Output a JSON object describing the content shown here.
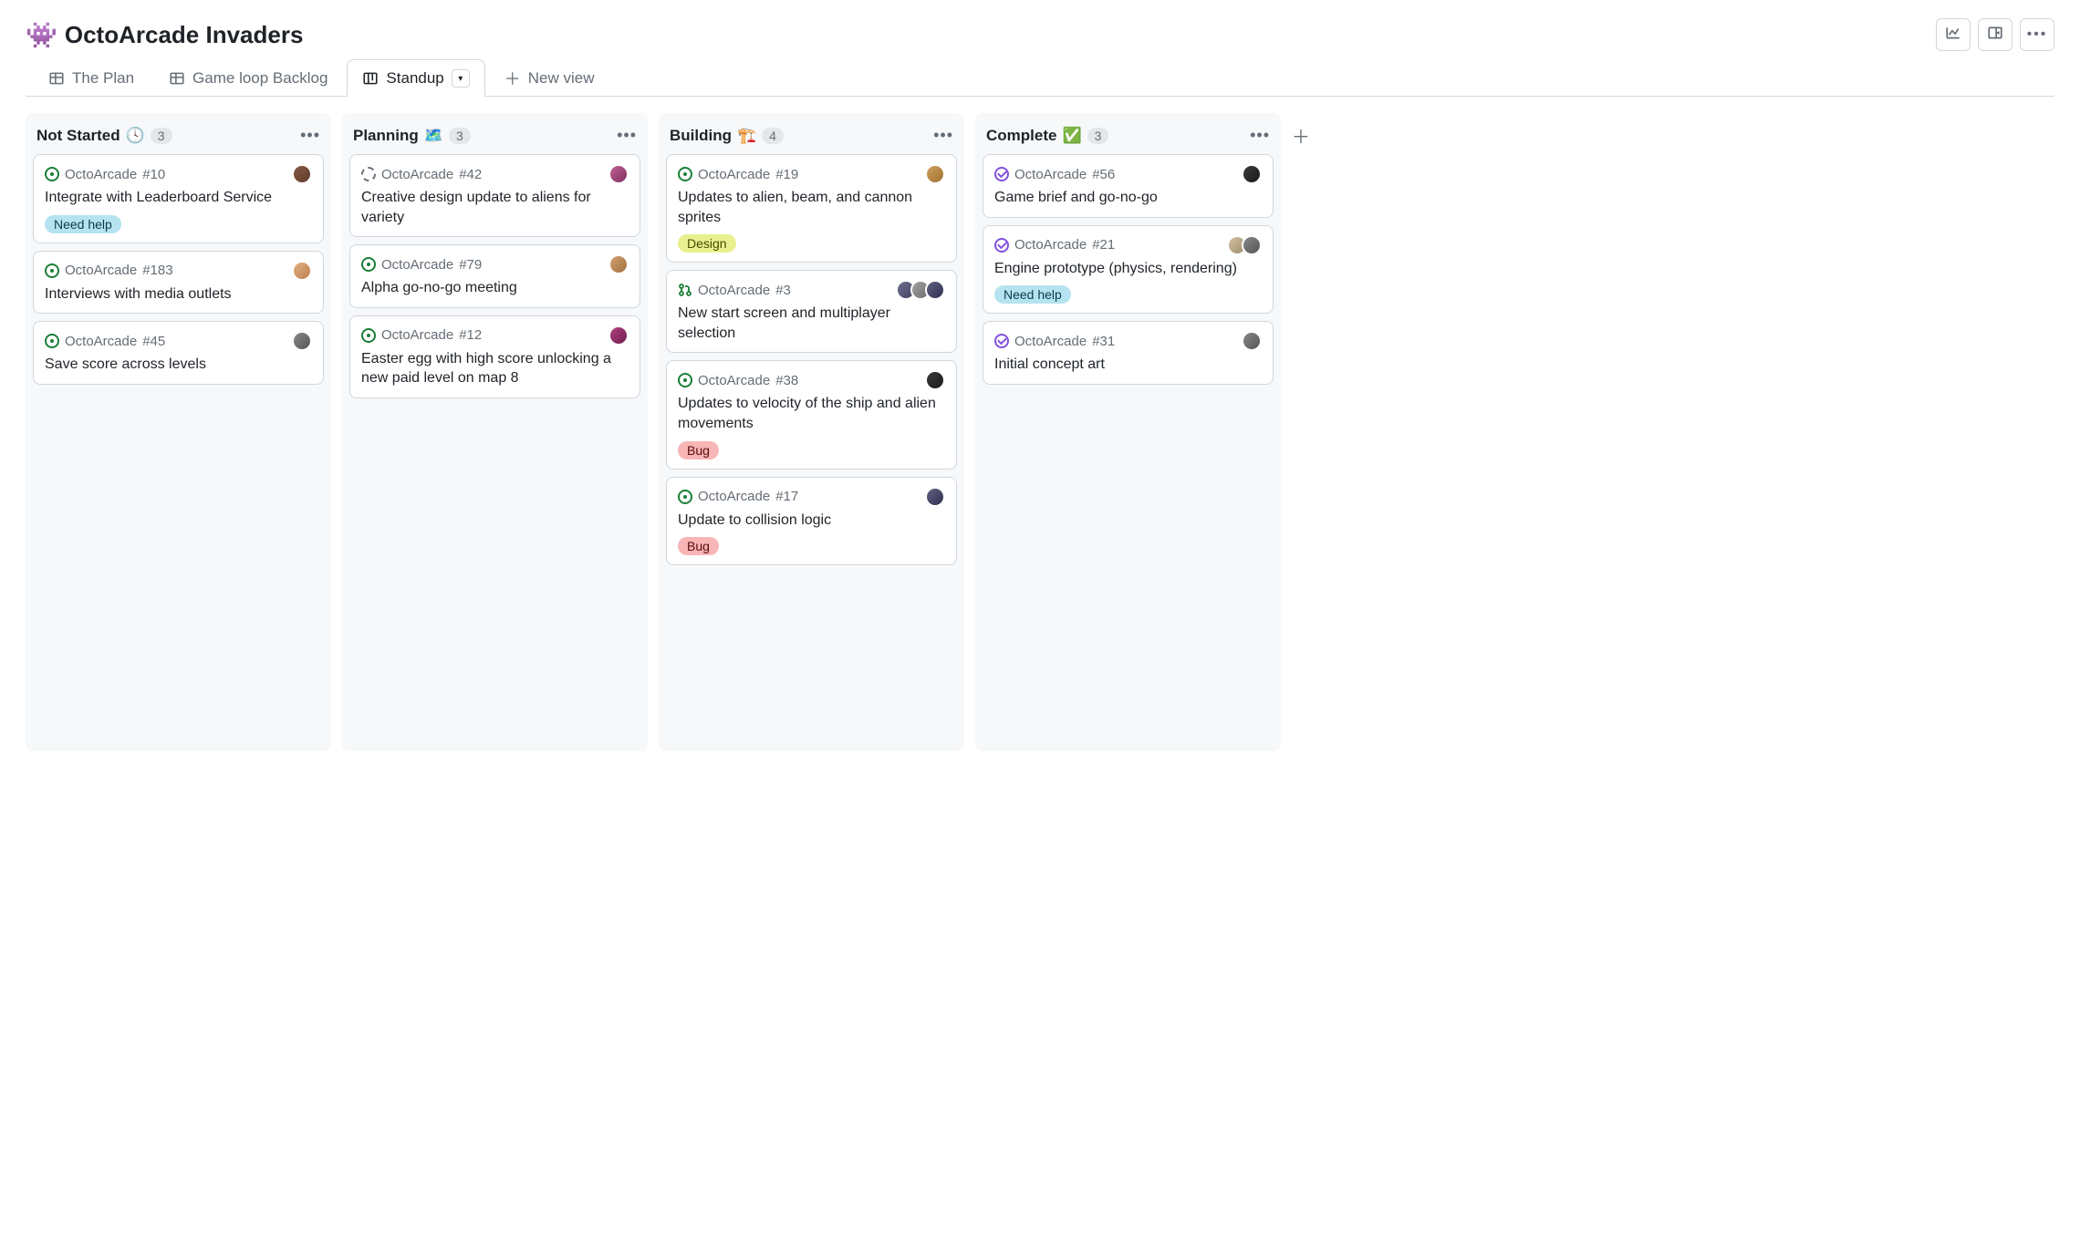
{
  "header": {
    "emoji": "👾",
    "title": "OctoArcade Invaders"
  },
  "tabs": [
    {
      "label": "The Plan",
      "type": "table",
      "active": false
    },
    {
      "label": "Game loop Backlog",
      "type": "table",
      "active": false
    },
    {
      "label": "Standup",
      "type": "board",
      "active": true
    },
    {
      "label": "New view",
      "type": "new",
      "active": false
    }
  ],
  "labels": {
    "needhelp": "Need help",
    "design": "Design",
    "bug": "Bug"
  },
  "columns": [
    {
      "title": "Not Started",
      "emoji": "🕓",
      "count": "3",
      "cards": [
        {
          "repo": "OctoArcade",
          "num": "#10",
          "status": "open",
          "title": "Integrate with Leaderboard Service",
          "labels": [
            "needhelp"
          ],
          "avatars": [
            "av1"
          ]
        },
        {
          "repo": "OctoArcade",
          "num": "#183",
          "status": "open",
          "title": "Interviews with media outlets",
          "labels": [],
          "avatars": [
            "av2"
          ]
        },
        {
          "repo": "OctoArcade",
          "num": "#45",
          "status": "open",
          "title": "Save score across levels",
          "labels": [],
          "avatars": [
            "av3"
          ]
        }
      ]
    },
    {
      "title": "Planning",
      "emoji": "🗺️",
      "count": "3",
      "cards": [
        {
          "repo": "OctoArcade",
          "num": "#42",
          "status": "draft",
          "title": "Creative design update to aliens for variety",
          "labels": [],
          "avatars": [
            "av4"
          ]
        },
        {
          "repo": "OctoArcade",
          "num": "#79",
          "status": "open",
          "title": "Alpha go-no-go meeting",
          "labels": [],
          "avatars": [
            "av5"
          ]
        },
        {
          "repo": "OctoArcade",
          "num": "#12",
          "status": "open",
          "title": "Easter egg with high score unlocking a new paid level on map 8",
          "labels": [],
          "avatars": [
            "av6"
          ]
        }
      ]
    },
    {
      "title": "Building",
      "emoji": "🏗️",
      "count": "4",
      "cards": [
        {
          "repo": "OctoArcade",
          "num": "#19",
          "status": "open",
          "title": "Updates to alien, beam, and cannon sprites",
          "labels": [
            "design"
          ],
          "avatars": [
            "av7"
          ]
        },
        {
          "repo": "OctoArcade",
          "num": "#3",
          "status": "pr",
          "title": "New start screen and multiplayer selection",
          "labels": [],
          "avatars": [
            "av8",
            "av9",
            "av10"
          ]
        },
        {
          "repo": "OctoArcade",
          "num": "#38",
          "status": "open",
          "title": "Updates to velocity of the ship and alien movements",
          "labels": [
            "bug"
          ],
          "avatars": [
            "av11"
          ]
        },
        {
          "repo": "OctoArcade",
          "num": "#17",
          "status": "open",
          "title": "Update to collision logic",
          "labels": [
            "bug"
          ],
          "avatars": [
            "av10"
          ]
        }
      ]
    },
    {
      "title": "Complete",
      "emoji": "✅",
      "count": "3",
      "cards": [
        {
          "repo": "OctoArcade",
          "num": "#56",
          "status": "done",
          "title": "Game brief and go-no-go",
          "labels": [],
          "avatars": [
            "av11"
          ]
        },
        {
          "repo": "OctoArcade",
          "num": "#21",
          "status": "done",
          "title": "Engine prototype (physics, rendering)",
          "labels": [
            "needhelp"
          ],
          "avatars": [
            "av12",
            "av3"
          ]
        },
        {
          "repo": "OctoArcade",
          "num": "#31",
          "status": "done",
          "title": "Initial concept art",
          "labels": [],
          "avatars": [
            "av3"
          ]
        }
      ]
    }
  ]
}
